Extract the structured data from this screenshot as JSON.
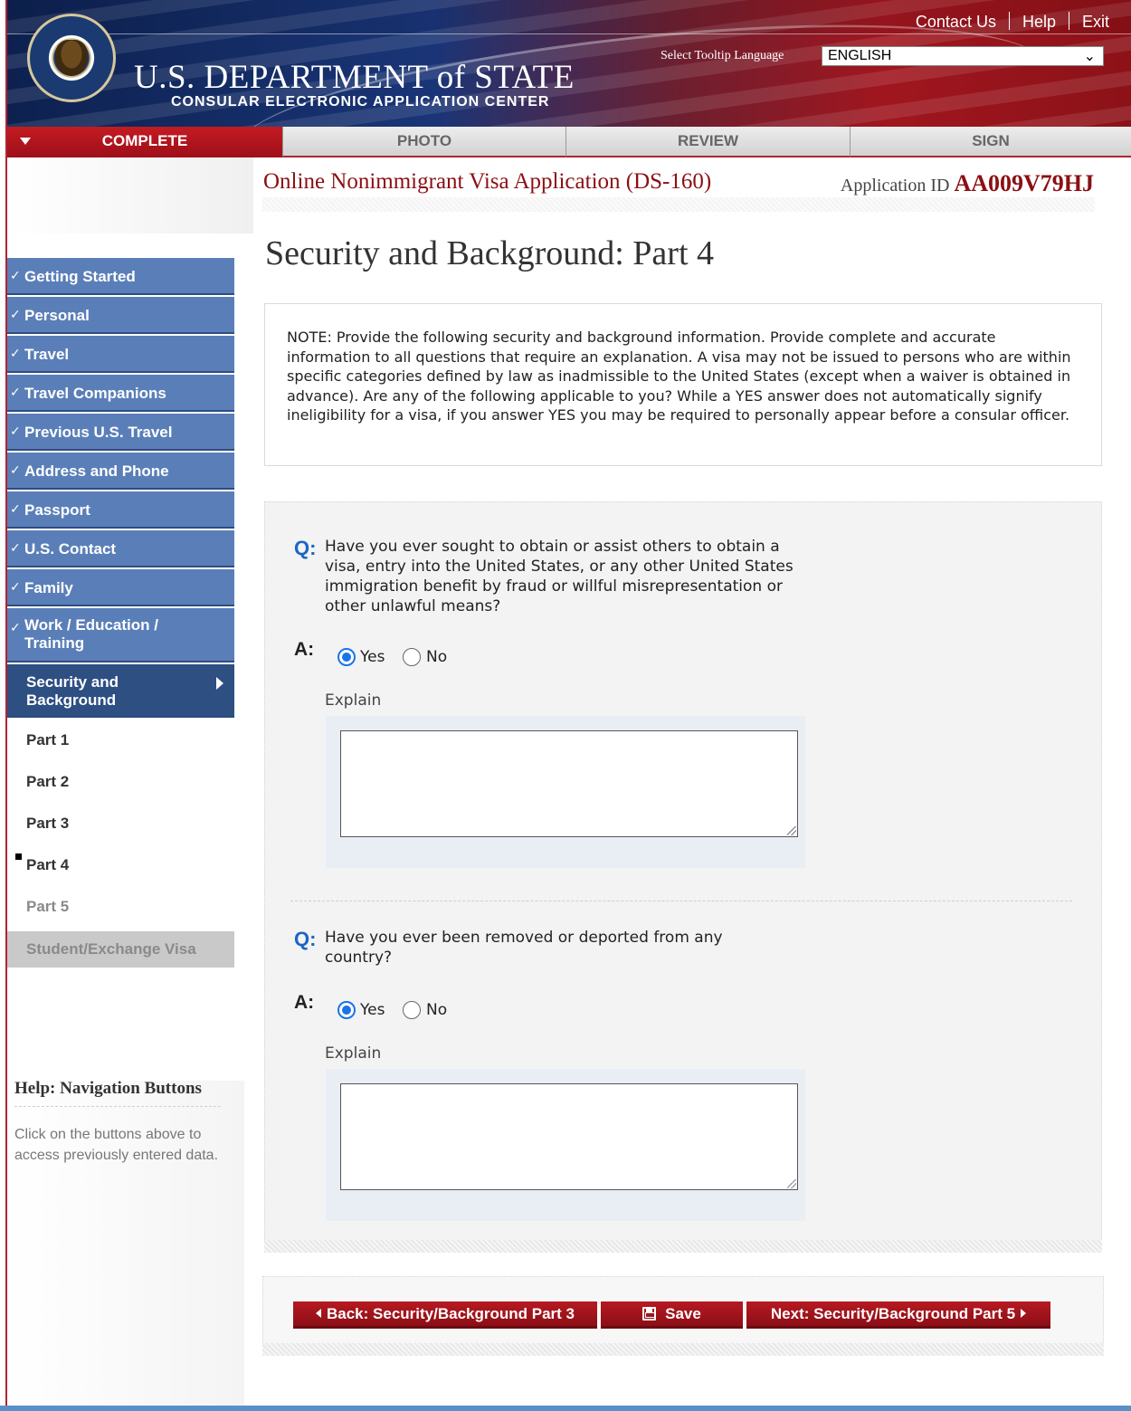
{
  "header": {
    "utility_links": [
      "Contact Us",
      "Help",
      "Exit"
    ],
    "brand_title": "U.S. DEPARTMENT of STATE",
    "brand_subtitle": "CONSULAR ELECTRONIC APPLICATION CENTER",
    "tooltip_language_label": "Select Tooltip Language",
    "tooltip_language_value": "ENGLISH"
  },
  "tabs": [
    {
      "label": "COMPLETE",
      "active": true
    },
    {
      "label": "PHOTO",
      "active": false
    },
    {
      "label": "REVIEW",
      "active": false
    },
    {
      "label": "SIGN",
      "active": false
    }
  ],
  "sidebar": {
    "sections": [
      {
        "label": "Getting Started",
        "completed": true
      },
      {
        "label": "Personal",
        "completed": true
      },
      {
        "label": "Travel",
        "completed": true
      },
      {
        "label": "Travel Companions",
        "completed": true
      },
      {
        "label": "Previous U.S. Travel",
        "completed": true
      },
      {
        "label": "Address and Phone",
        "completed": true
      },
      {
        "label": "Passport",
        "completed": true
      },
      {
        "label": "U.S. Contact",
        "completed": true
      },
      {
        "label": "Family",
        "completed": true
      },
      {
        "label": "Work / Education / Training",
        "completed": true
      },
      {
        "label": "Security and Background",
        "completed": false,
        "current": true
      }
    ],
    "subitems": [
      {
        "label": "Part 1",
        "enabled": true
      },
      {
        "label": "Part 2",
        "enabled": true
      },
      {
        "label": "Part 3",
        "enabled": true
      },
      {
        "label": "Part 4",
        "enabled": true,
        "current": true
      },
      {
        "label": "Part 5",
        "enabled": false
      }
    ],
    "disabled_section": "Student/Exchange Visa",
    "help": {
      "title_prefix": "Help:",
      "title": "Navigation Buttons",
      "body": "Click on the buttons above to access previously entered data."
    }
  },
  "main": {
    "form_title": "Online Nonimmigrant Visa Application (DS-160)",
    "application_id_label": "Application ID",
    "application_id": "AA009V79HJ",
    "page_heading": "Security and Background: Part 4",
    "note": "NOTE: Provide the following security and background information. Provide complete and accurate information to all questions that require an explanation. A visa may not be issued to persons who are within specific categories defined by law as inadmissible to the United States (except when a waiver is obtained in advance). Are any of the following applicable to you? While a YES answer does not automatically signify ineligibility for a visa, if you answer YES you may be required to personally appear before a consular officer.",
    "q_marker": "Q:",
    "a_marker": "A:",
    "questions": [
      {
        "text": "Have you ever sought to obtain or assist others to obtain a visa, entry into the United States, or any other United States immigration benefit by fraud or willful misrepresentation or other unlawful means?",
        "options": [
          "Yes",
          "No"
        ],
        "selected": "Yes",
        "explain_label": "Explain",
        "explain_value": ""
      },
      {
        "text": "Have you ever been removed or deported from any country?",
        "options": [
          "Yes",
          "No"
        ],
        "selected": "Yes",
        "explain_label": "Explain",
        "explain_value": ""
      }
    ],
    "buttons": {
      "back": "Back: Security/Background Part 3",
      "save": "Save",
      "next": "Next: Security/Background Part 5"
    }
  },
  "colors": {
    "brand_red": "#8b0f14",
    "nav_blue": "#5a7fb8",
    "nav_current": "#2d4f82",
    "question_blue": "#1a66c4"
  }
}
